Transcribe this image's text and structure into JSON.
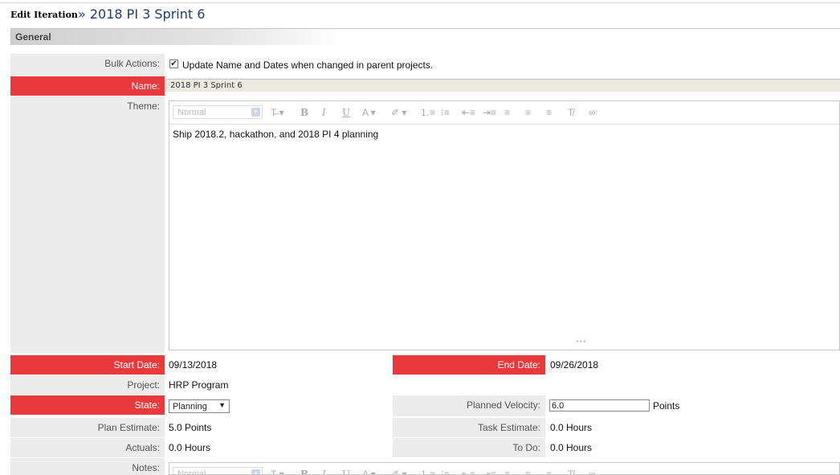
{
  "header": {
    "edit_label": "Edit Iteration",
    "title": "» 2018 PI 3 Sprint 6"
  },
  "section": {
    "title": "General"
  },
  "bulk_actions": {
    "label": "Bulk Actions:",
    "checkbox_text": "Update Name and Dates when changed in parent projects.",
    "checked": true
  },
  "name": {
    "label": "Name:",
    "value": "2018 PI 3 Sprint 6"
  },
  "theme": {
    "label": "Theme:",
    "content": "Ship 2018.2, hackathon, and 2018 PI 4 planning"
  },
  "editor_toolbar": {
    "format_placeholder": "Normal",
    "format_arrow": "▾",
    "buttons": [
      {
        "name": "font-size-icon",
        "glyph": "T̶ ▾"
      },
      {
        "name": "bold-icon",
        "glyph": "B"
      },
      {
        "name": "italic-icon",
        "glyph": "I"
      },
      {
        "name": "underline-icon",
        "glyph": "U"
      },
      {
        "name": "text-color-icon",
        "glyph": "A ▾"
      },
      {
        "name": "highlight-icon",
        "glyph": "✐ ▾"
      },
      {
        "name": "numbered-list-icon",
        "glyph": "⒈≡"
      },
      {
        "name": "bulleted-list-icon",
        "glyph": "⁝≡"
      },
      {
        "name": "outdent-icon",
        "glyph": "⇤≡"
      },
      {
        "name": "indent-icon",
        "glyph": "⇥≡"
      },
      {
        "name": "align-left-icon",
        "glyph": "≡"
      },
      {
        "name": "align-center-icon",
        "glyph": "≡"
      },
      {
        "name": "align-right-icon",
        "glyph": "≡"
      },
      {
        "name": "clear-format-icon",
        "glyph": "T̸"
      },
      {
        "name": "link-icon",
        "glyph": "∞"
      }
    ],
    "resize_handle": "•••"
  },
  "start_date": {
    "label": "Start Date:",
    "value": "09/13/2018"
  },
  "end_date": {
    "label": "End Date:",
    "value": "09/26/2018"
  },
  "project": {
    "label": "Project:",
    "value": "HRP Program"
  },
  "state": {
    "label": "State:",
    "value": "Planning",
    "arrow": "▼"
  },
  "planned_velocity": {
    "label": "Planned Velocity:",
    "value": "6.0",
    "unit": "Points"
  },
  "plan_estimate": {
    "label": "Plan Estimate:",
    "value": "5.0 Points"
  },
  "task_estimate": {
    "label": "Task Estimate:",
    "value": "0.0 Hours"
  },
  "actuals": {
    "label": "Actuals:",
    "value": "0.0 Hours"
  },
  "to_do": {
    "label": "To Do:",
    "value": "0.0 Hours"
  },
  "notes": {
    "label": "Notes:"
  },
  "colors": {
    "required_label_bg": "#e8393c",
    "label_bg": "#ececec",
    "title_color": "#1c3d6e"
  }
}
